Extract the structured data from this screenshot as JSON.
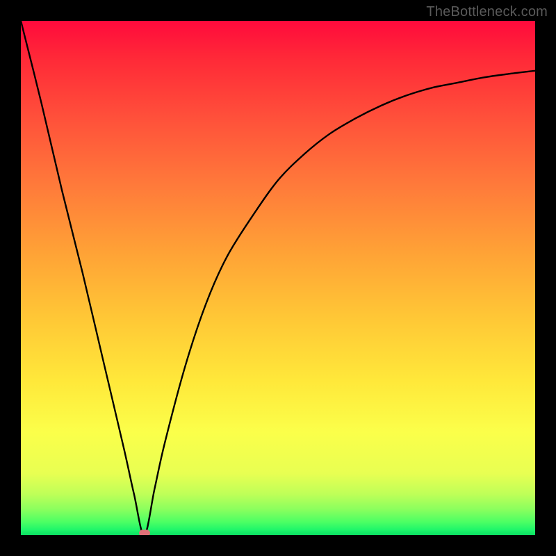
{
  "watermark": "TheBottleneck.com",
  "chart_data": {
    "type": "line",
    "title": "",
    "xlabel": "",
    "ylabel": "",
    "xlim": [
      0,
      100
    ],
    "ylim": [
      0,
      100
    ],
    "grid": false,
    "legend": false,
    "notes": "Vertical rainbow gradient (red top to green bottom) with a black bottleneck curve; minimum near x≈24; a small pink marker sits at the minimum on the baseline.",
    "series": [
      {
        "name": "bottleneck-curve",
        "x": [
          0,
          4,
          8,
          12,
          16,
          20,
          22,
          24,
          26,
          28,
          32,
          36,
          40,
          45,
          50,
          55,
          60,
          65,
          70,
          75,
          80,
          85,
          90,
          95,
          100
        ],
        "y": [
          100,
          84,
          67,
          51,
          34,
          17,
          8,
          0,
          9,
          18,
          33,
          45,
          54,
          62,
          69,
          74,
          78,
          81,
          83.5,
          85.5,
          87,
          88,
          89,
          89.7,
          90.3
        ]
      }
    ],
    "marker": {
      "x": 24,
      "y": 0
    },
    "background_gradient_stops": [
      {
        "pos": 0,
        "color": "#ff0a3c"
      },
      {
        "pos": 7,
        "color": "#ff2838"
      },
      {
        "pos": 20,
        "color": "#ff543a"
      },
      {
        "pos": 32,
        "color": "#ff7a3a"
      },
      {
        "pos": 45,
        "color": "#ffa236"
      },
      {
        "pos": 58,
        "color": "#ffc836"
      },
      {
        "pos": 70,
        "color": "#ffe83a"
      },
      {
        "pos": 80,
        "color": "#fbff4a"
      },
      {
        "pos": 88,
        "color": "#e8ff52"
      },
      {
        "pos": 92,
        "color": "#bfff58"
      },
      {
        "pos": 95,
        "color": "#8aff5e"
      },
      {
        "pos": 97.5,
        "color": "#4aff64"
      },
      {
        "pos": 99,
        "color": "#1ef56a"
      },
      {
        "pos": 100,
        "color": "#0ade62"
      }
    ]
  }
}
